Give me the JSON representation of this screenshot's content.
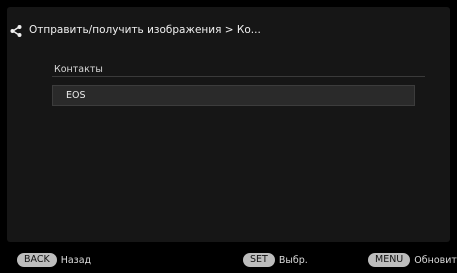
{
  "header": {
    "icon": "share-icon",
    "title": "Отправить/получить изображения > Ко..."
  },
  "section": {
    "label": "Контакты"
  },
  "list": {
    "items": [
      {
        "label": "EOS"
      }
    ]
  },
  "footer": {
    "back": {
      "key": "BACK",
      "label": "Назад"
    },
    "set": {
      "key": "SET",
      "label": "Выбр."
    },
    "menu": {
      "key": "MENU",
      "label": "Обновить"
    }
  }
}
